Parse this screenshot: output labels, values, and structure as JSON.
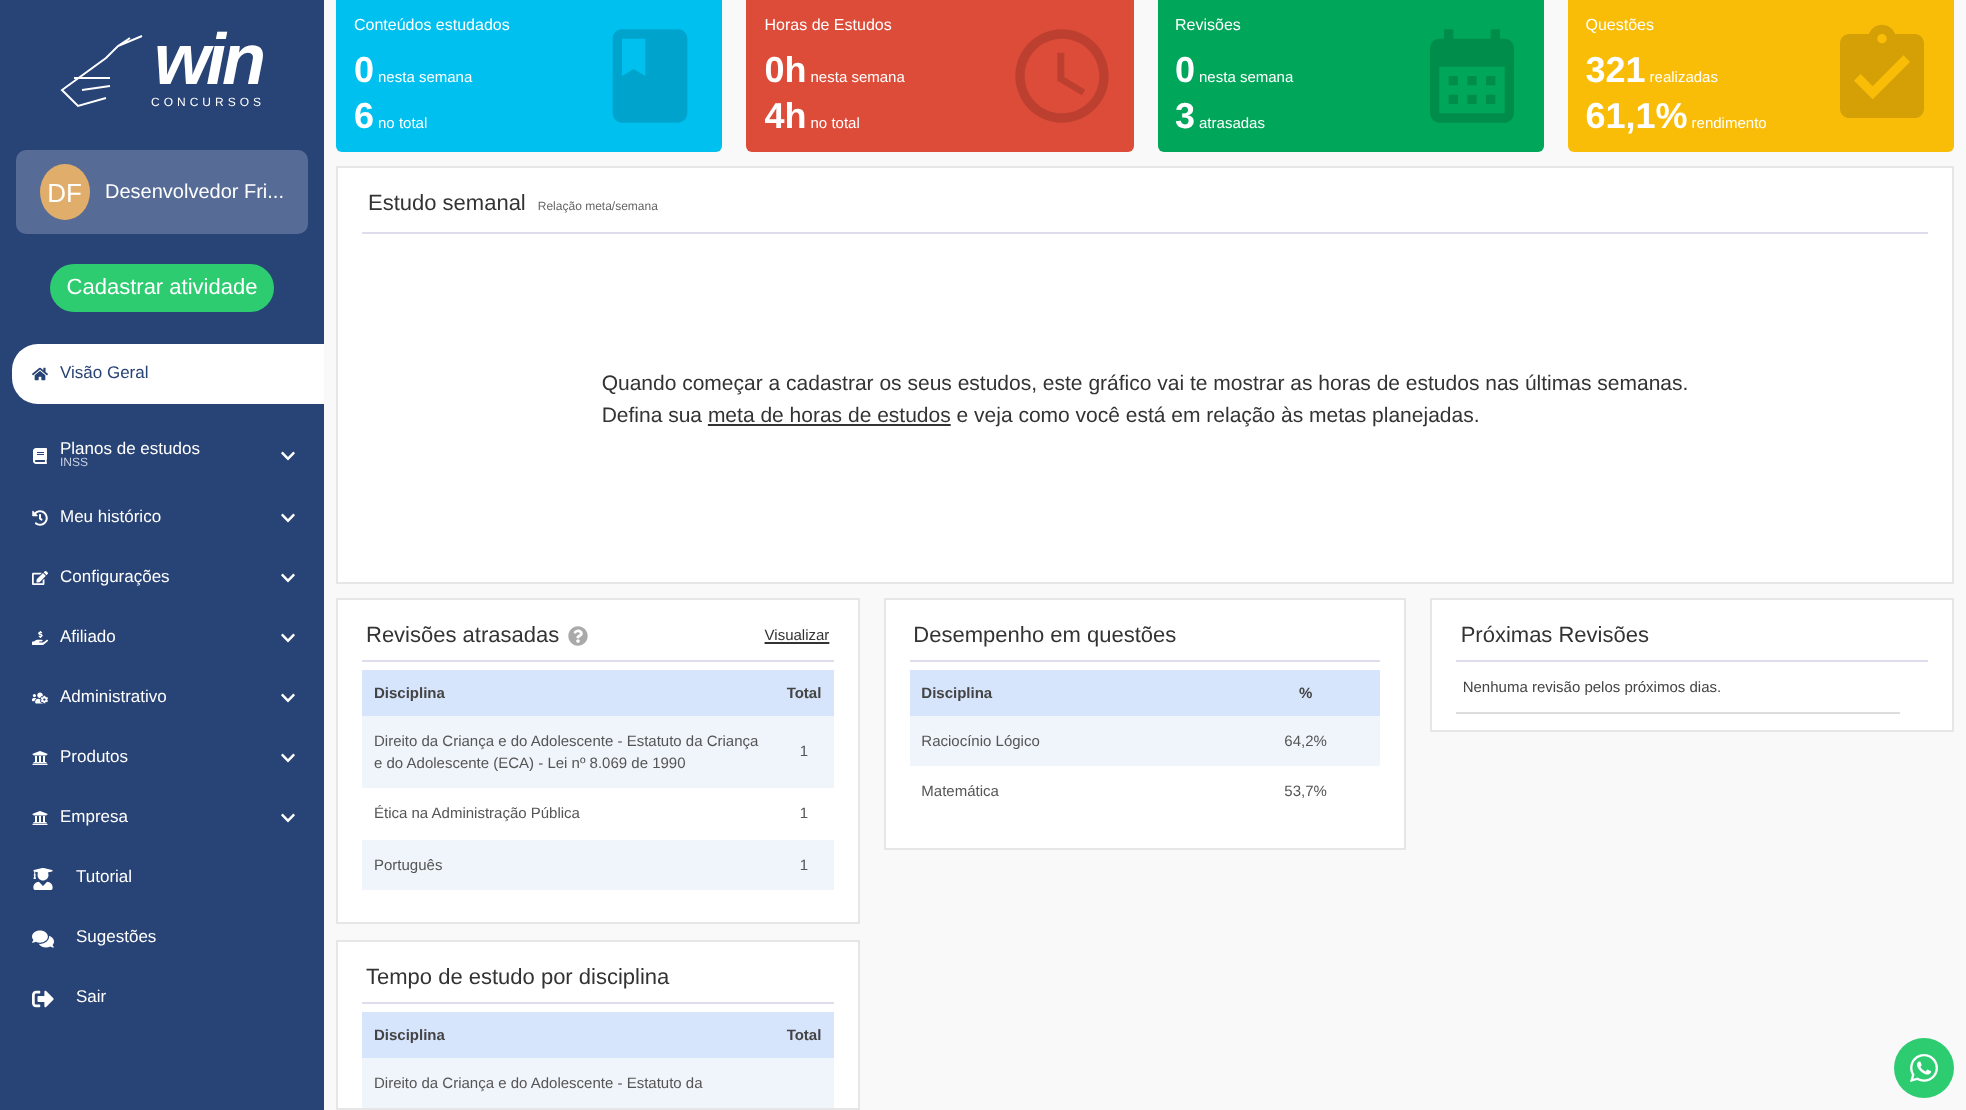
{
  "sidebar": {
    "logo": {
      "word": "win",
      "tagline": "CONCURSOS"
    },
    "user": {
      "initials": "DF",
      "name": "Desenvolvedor Fri..."
    },
    "action_button": "Cadastrar atividade",
    "items": [
      {
        "kind": "link",
        "label": "Visão Geral",
        "selected": true
      },
      {
        "kind": "menu",
        "label": "Planos de estudos",
        "sub": "INSS",
        "selected": false
      },
      {
        "kind": "menu",
        "label": "Meu histórico",
        "selected": false
      },
      {
        "kind": "menu",
        "label": "Configurações",
        "selected": false
      },
      {
        "kind": "menu",
        "label": "Afiliado",
        "selected": false
      },
      {
        "kind": "menu",
        "label": "Administrativo",
        "selected": false
      },
      {
        "kind": "menu",
        "label": "Produtos",
        "selected": false
      },
      {
        "kind": "menu",
        "label": "Empresa",
        "selected": false
      },
      {
        "kind": "link",
        "label": "Tutorial",
        "selected": false
      },
      {
        "kind": "link",
        "label": "Sugestões",
        "selected": false
      },
      {
        "kind": "link",
        "label": "Sair",
        "selected": false
      }
    ]
  },
  "stats": [
    {
      "title": "Conteúdos estudados",
      "color": "#00c0ef",
      "lines": [
        {
          "value": "0",
          "label": "nesta semana"
        },
        {
          "value": "6",
          "label": "no total"
        }
      ]
    },
    {
      "title": "Horas de Estudos",
      "color": "#dd4b39",
      "lines": [
        {
          "value": "0h",
          "label": "nesta semana"
        },
        {
          "value": "4h",
          "label": "no total"
        }
      ]
    },
    {
      "title": "Revisões",
      "color": "#00a65a",
      "lines": [
        {
          "value": "0",
          "label": "nesta semana"
        },
        {
          "value": "3",
          "label": "atrasadas"
        }
      ]
    },
    {
      "title": "Questões",
      "color": "#f9bd08",
      "lines": [
        {
          "value": "321",
          "label": "realizadas"
        },
        {
          "value": "61,1%",
          "label": "rendimento"
        }
      ]
    }
  ],
  "weekly": {
    "title": "Estudo semanal",
    "subtitle": "Relação meta/semana",
    "line_1": "Quando começar a cadastrar os seus estudos, este gráfico vai te mostrar as horas de estudos nas últimas semanas.",
    "line_2_before": "Defina sua",
    "link": "meta de horas de estudos",
    "line_2_after": "e veja como você está em relação às metas planejadas."
  },
  "overdue_reviews": {
    "title": "Revisões atrasadas",
    "link": "Visualizar",
    "columns": [
      "Disciplina",
      "Total"
    ],
    "rows": [
      [
        "Direito da Criança e do Adolescente - Estatuto da Criança e do Adolescente (ECA) - Lei nº 8.069 de 1990",
        "1"
      ],
      [
        "Ética na Administração Pública",
        "1"
      ],
      [
        "Português",
        "1"
      ]
    ]
  },
  "study_time": {
    "title": "Tempo de estudo por disciplina",
    "columns": [
      "Disciplina",
      "Total"
    ],
    "rows": [
      [
        "Direito da Criança e do Adolescente - Estatuto da",
        ""
      ]
    ]
  },
  "performance": {
    "title": "Desempenho em questões",
    "columns": [
      "Disciplina",
      "%"
    ],
    "rows": [
      [
        "Raciocínio Lógico",
        "64,2%"
      ],
      [
        "Matemática",
        "53,7%"
      ]
    ]
  },
  "next_reviews": {
    "title": "Próximas Revisões",
    "empty": "Nenhuma revisão pelos próximos dias."
  }
}
